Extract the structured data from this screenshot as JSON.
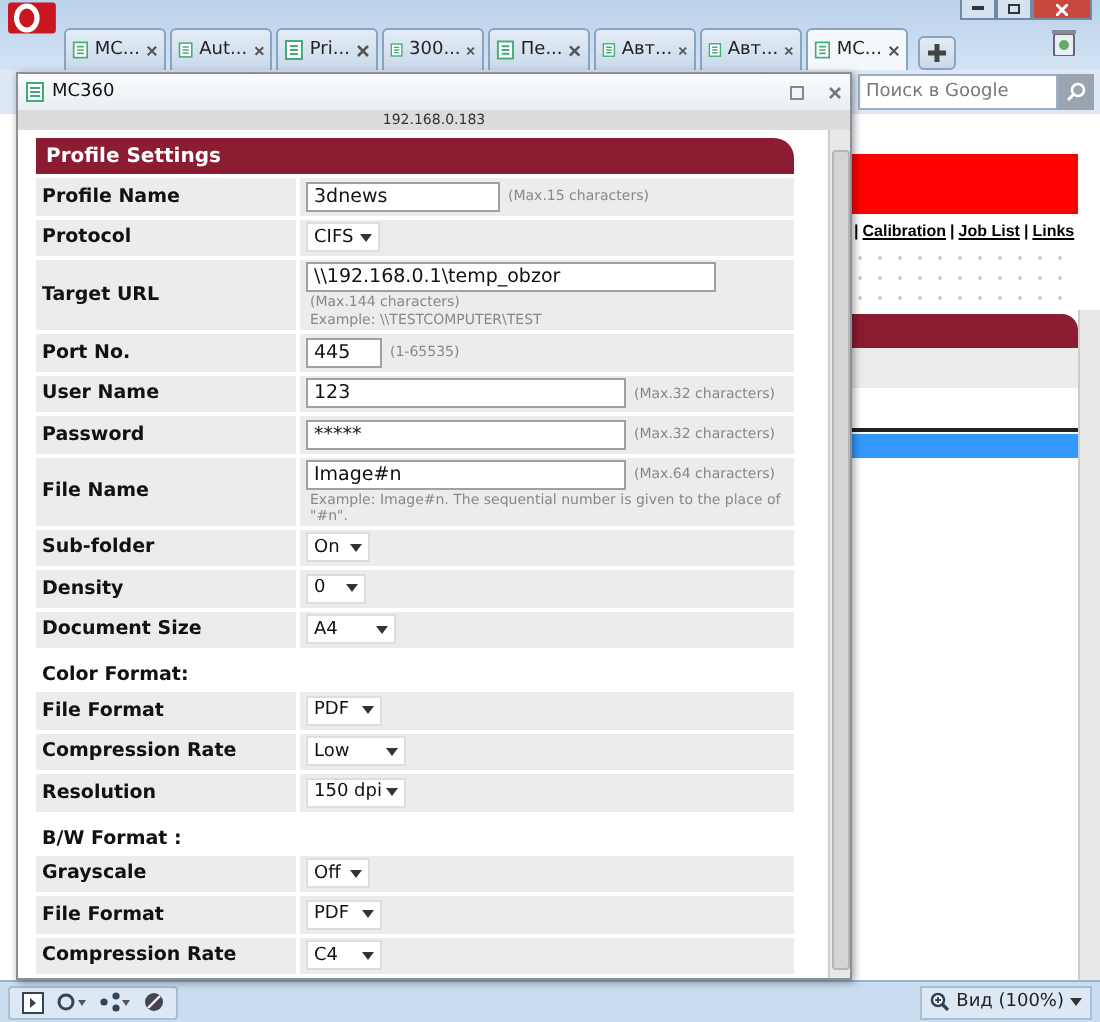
{
  "browser": {
    "tabs": [
      {
        "label": "MC...",
        "selected": false
      },
      {
        "label": "Aut...",
        "selected": false
      },
      {
        "label": "Pri...",
        "selected": false
      },
      {
        "label": "300...",
        "selected": false
      },
      {
        "label": "Пе...",
        "selected": false
      },
      {
        "label": "Авт...",
        "selected": false
      },
      {
        "label": "Авт...",
        "selected": false
      },
      {
        "label": "MC...",
        "selected": true
      }
    ],
    "search": {
      "placeholder": "Поиск в Google"
    }
  },
  "page": {
    "links": [
      {
        "separator": "|",
        "label": "Calibration"
      },
      {
        "separator": "|",
        "label": "Job List"
      },
      {
        "separator": "|",
        "label": "Links"
      }
    ]
  },
  "popup": {
    "title": "MC360",
    "address": "192.168.0.183",
    "header": "Profile Settings",
    "sections": [
      {
        "rows": [
          {
            "kind": "input",
            "label": "Profile Name",
            "value": "3dnews",
            "hint": "(Max.15 characters)"
          },
          {
            "kind": "select",
            "label": "Protocol",
            "value": "CIFS"
          },
          {
            "kind": "input",
            "label": "Target URL",
            "value": "\\\\192.168.0.1\\temp_obzor",
            "notes": [
              "(Max.144 characters)",
              "Example: \\\\TESTCOMPUTER\\TEST"
            ]
          },
          {
            "kind": "input",
            "label": "Port No.",
            "value": "445",
            "hint": "(1-65535)"
          },
          {
            "kind": "input",
            "label": "User Name",
            "value": "123",
            "hint": "(Max.32 characters)"
          },
          {
            "kind": "input",
            "label": "Password",
            "value": "*****",
            "hint": "(Max.32 characters)"
          },
          {
            "kind": "input",
            "label": "File Name",
            "value": "Image#n",
            "hint": "(Max.64 characters)",
            "notes": [
              "Example: Image#n. The sequential number is given to the place of \"#n\"."
            ]
          },
          {
            "kind": "select",
            "label": "Sub-folder",
            "value": "On"
          },
          {
            "kind": "select",
            "label": "Density",
            "value": "0"
          },
          {
            "kind": "select",
            "label": "Document Size",
            "value": "A4"
          }
        ]
      },
      {
        "title": "Color Format:",
        "rows": [
          {
            "kind": "select",
            "label": "File Format",
            "value": "PDF"
          },
          {
            "kind": "select",
            "label": "Compression Rate",
            "value": "Low"
          },
          {
            "kind": "select",
            "label": "Resolution",
            "value": "150 dpi"
          }
        ]
      },
      {
        "title": "B/W Format :",
        "rows": [
          {
            "kind": "select",
            "label": "Grayscale",
            "value": "Off"
          },
          {
            "kind": "select",
            "label": "File Format",
            "value": "PDF"
          },
          {
            "kind": "select",
            "label": "Compression Rate",
            "value": "C4"
          }
        ]
      }
    ]
  },
  "status_bar": {
    "zoom_label": "Вид (100%)"
  }
}
